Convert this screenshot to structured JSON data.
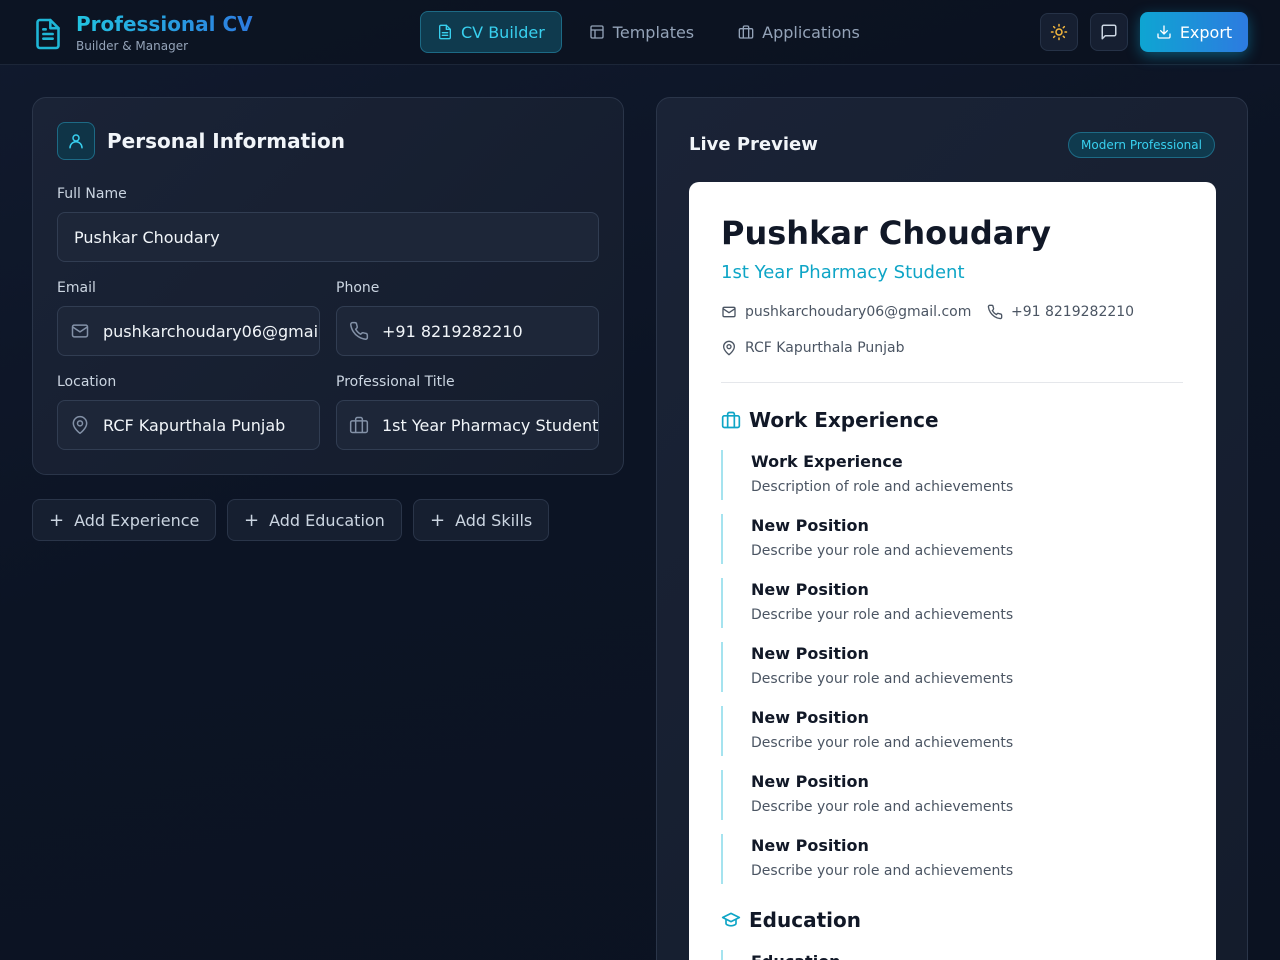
{
  "header": {
    "brand_title": "Professional CV",
    "brand_subtitle": "Builder & Manager",
    "nav": [
      {
        "label": "CV Builder",
        "icon": "file-text-icon",
        "active": true
      },
      {
        "label": "Templates",
        "icon": "layout-icon",
        "active": false
      },
      {
        "label": "Applications",
        "icon": "briefcase-icon",
        "active": false
      }
    ],
    "theme_toggle_icon": "sun-icon",
    "feedback_icon": "message-square-icon",
    "export_label": "Export",
    "accent": "#0ea5d2"
  },
  "personal": {
    "title": "Personal Information",
    "full_name_label": "Full Name",
    "full_name": "Pushkar Choudary",
    "email_label": "Email",
    "email": "pushkarchoudary06@gmail.com",
    "phone_label": "Phone",
    "phone": "+91 8219282210",
    "location_label": "Location",
    "location": "RCF Kapurthala Punjab",
    "professional_title_label": "Professional Title",
    "professional_title": "1st Year Pharmacy Student"
  },
  "actions": {
    "add_experience": "Add Experience",
    "add_education": "Add Education",
    "add_skills": "Add Skills"
  },
  "preview": {
    "title": "Live Preview",
    "template_badge": "Modern Professional",
    "cv": {
      "name": "Pushkar Choudary",
      "title": "1st Year Pharmacy Student",
      "email": "pushkarchoudary06@gmail.com",
      "phone": "+91 8219282210",
      "location": "RCF Kapurthala Punjab",
      "work_heading": "Work Experience",
      "experience": [
        {
          "title": "Work Experience",
          "desc": "Description of role and achievements"
        },
        {
          "title": "New Position",
          "desc": "Describe your role and achievements"
        },
        {
          "title": "New Position",
          "desc": "Describe your role and achievements"
        },
        {
          "title": "New Position",
          "desc": "Describe your role and achievements"
        },
        {
          "title": "New Position",
          "desc": "Describe your role and achievements"
        },
        {
          "title": "New Position",
          "desc": "Describe your role and achievements"
        },
        {
          "title": "New Position",
          "desc": "Describe your role and achievements"
        }
      ],
      "education_heading": "Education",
      "education": [
        {
          "title": "Education"
        }
      ]
    }
  }
}
